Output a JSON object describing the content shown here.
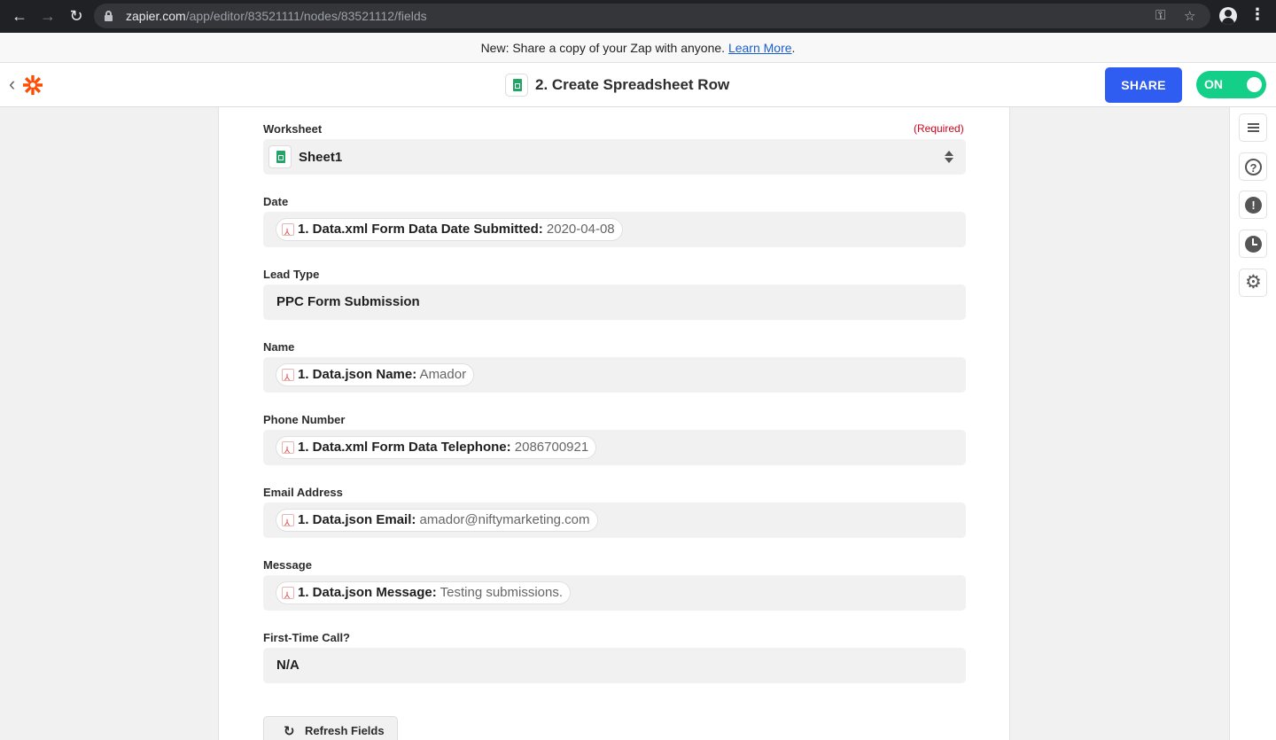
{
  "browser": {
    "url_host": "zapier.com",
    "url_path": "/app/editor/83521111/nodes/83521112/fields"
  },
  "announcement": {
    "text": "New: Share a copy of your Zap with anyone. ",
    "link_text": "Learn More",
    "suffix": "."
  },
  "header": {
    "step_title": "2. Create Spreadsheet Row",
    "share_label": "SHARE",
    "toggle_label": "ON"
  },
  "form": {
    "worksheet": {
      "label": "Worksheet",
      "required_text": "(Required)",
      "value": "Sheet1"
    },
    "fields": [
      {
        "label": "Date",
        "pill_key": "1. Data.xml Form Data Date Submitted:",
        "pill_value": " 2020-04-08"
      },
      {
        "label": "Lead Type",
        "value": "PPC Form Submission"
      },
      {
        "label": "Name",
        "pill_key": "1. Data.json Name:",
        "pill_value": " Amador"
      },
      {
        "label": "Phone Number",
        "pill_key": "1. Data.xml Form Data Telephone:",
        "pill_value": " 2086700921"
      },
      {
        "label": "Email Address",
        "pill_key": "1. Data.json Email:",
        "pill_value": " amador@niftymarketing.com"
      },
      {
        "label": "Message",
        "pill_key": "1. Data.json Message:",
        "pill_value": " Testing submissions."
      },
      {
        "label": "First-Time Call?",
        "value": "N/A"
      }
    ],
    "refresh_label": "Refresh Fields"
  },
  "icons": {
    "rail": [
      "outline-lines-icon",
      "help-icon",
      "alert-icon",
      "history-icon",
      "settings-gear-icon"
    ]
  },
  "colors": {
    "share_button": "#2f5cf1",
    "toggle_on": "#14cf88",
    "required": "#d0021b",
    "link": "#1a5fd0",
    "zapier_orange": "#ff4a00"
  }
}
